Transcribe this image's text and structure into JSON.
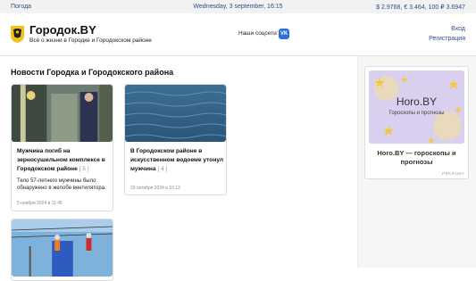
{
  "topbar": {
    "weather_label": "Погода",
    "date": "Wednesday, 3 september, 16:15",
    "rates": "$ 2.9768, € 3.464, 100 ₽ 3.6947"
  },
  "header": {
    "site_title": "Городок.BY",
    "tagline": "Всё о жизни в Городке и Городокском районе",
    "social_label": "Наши соцсети:",
    "vk_icon_text": "VK",
    "login": "Вход",
    "register": "Регистрация"
  },
  "main": {
    "section_title": "Новости Городка и Городокского района",
    "articles": [
      {
        "title": "Мужчина погиб на зерносушильном комплексе в Городокском районе",
        "comments": "[ 5 ]",
        "description": "Тело 57-летнего мужчины было обнаружено в желобе вентилятора.",
        "date": "5 ноября 2024 в 11:45"
      },
      {
        "title": "В Городокском районе в искусственном водоеме утонул мужчина",
        "comments": "[ 4 ]",
        "description": "",
        "date": "29 октября 2024 в 10:12"
      },
      {
        "title": "",
        "comments": "",
        "description": "",
        "date": ""
      }
    ]
  },
  "sidebar": {
    "ad": {
      "brand": "Horo.BY",
      "subtitle": "Гороскопы и прогнозы",
      "title": "Horo.BY — гороскопы и прогнозы",
      "tag": "РЕКЛАМА"
    }
  },
  "colors": {
    "link": "#2a4f86",
    "vk": "#2d6fd6",
    "topbar_bg": "#f2f2f2"
  }
}
